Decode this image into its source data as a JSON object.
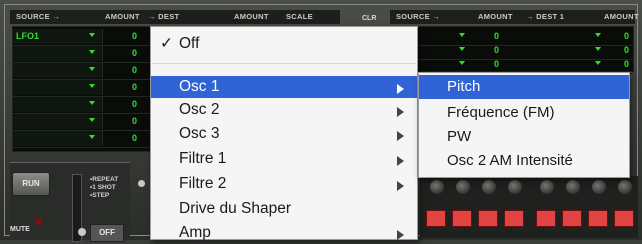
{
  "mod_header_left": {
    "source_label": "SOURCE →",
    "amount_label": "AMOUNT",
    "dest_label": "→ DEST",
    "amount2_label": "AMOUNT",
    "scale_label": "SCALE"
  },
  "mod_header_right": {
    "source_label": "SOURCE →",
    "amount_label": "AMOUNT",
    "dest_label": "→ DEST 1",
    "amount2_label": "AMOUNT"
  },
  "cls_label": "CLR",
  "left_rows": [
    {
      "source": "LFO1",
      "amount": "0"
    },
    {
      "source": "",
      "amount": "0"
    },
    {
      "source": "",
      "amount": "0"
    },
    {
      "source": "",
      "amount": "0"
    },
    {
      "source": "",
      "amount": "0"
    },
    {
      "source": "",
      "amount": "0"
    },
    {
      "source": "",
      "amount": "0"
    }
  ],
  "right_rows": [
    {
      "amount": "0",
      "amount2": "0"
    },
    {
      "amount": "0",
      "amount2": "0"
    },
    {
      "amount": "0",
      "amount2": "0"
    }
  ],
  "sequencer": {
    "run_label": "RUN",
    "mode_repeat": "•REPEAT",
    "mode_oneshot": "•1 SHOT",
    "mode_step": "•STEP",
    "mute_label": "MUTE",
    "off_label": "OFF"
  },
  "dest_menu": {
    "items": [
      {
        "label": "Off",
        "checked": true
      },
      {
        "label": "Osc 1",
        "submenu": true,
        "selected": true
      },
      {
        "label": "Osc 2",
        "submenu": true
      },
      {
        "label": "Osc 3",
        "submenu": true
      },
      {
        "label": "Filtre 1",
        "submenu": true
      },
      {
        "label": "Filtre 2",
        "submenu": true
      },
      {
        "label": "Drive du Shaper"
      },
      {
        "label": "Amp",
        "submenu": true
      }
    ],
    "check_glyph": "✓"
  },
  "osc1_submenu": {
    "items": [
      {
        "label": "Pitch",
        "selected": true
      },
      {
        "label": "Fréquence (FM)"
      },
      {
        "label": "PW"
      },
      {
        "label": "Osc 2 AM Intensité"
      }
    ]
  },
  "colors": {
    "lcd_text": "#2ee02e",
    "menu_highlight": "#2f63d6",
    "pad_red": "#e24343"
  }
}
